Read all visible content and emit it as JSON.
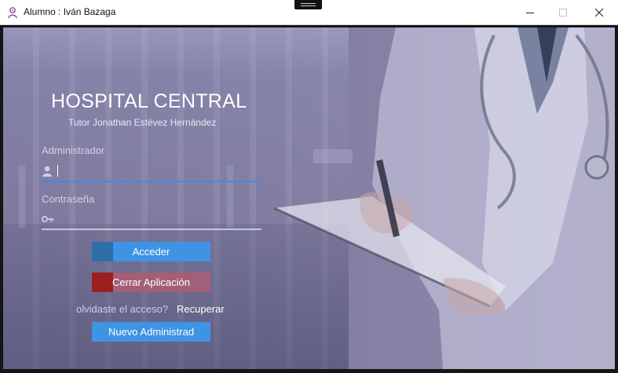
{
  "window": {
    "title": "Alumno : Iván Bazaga",
    "controls": {
      "minimize_icon": "minimize-icon",
      "maximize_icon": "maximize-icon",
      "close_icon": "close-icon"
    }
  },
  "login": {
    "title": "HOSPITAL CENTRAL",
    "subtitle": "Tutor Jonathan Estévez Hernández",
    "user_label": "Administrador",
    "user_value": "",
    "user_icon": "user-icon",
    "password_label": "Contraseña",
    "password_value": "",
    "password_icon": "key-icon",
    "access_button": "Acceder",
    "exit_button": "Cerrar Aplicación",
    "forgot_text": "olvidaste el acceso?",
    "recover_link": "Recuperar",
    "new_admin_button": "Nuevo Administrad"
  },
  "colors": {
    "overlay": "#817da1",
    "primary_button": "#3e94e3",
    "primary_accent": "#2e6fab",
    "danger_button": "#a35f77",
    "danger_accent": "#9d2020",
    "focused_underline": "#3b8de4"
  }
}
